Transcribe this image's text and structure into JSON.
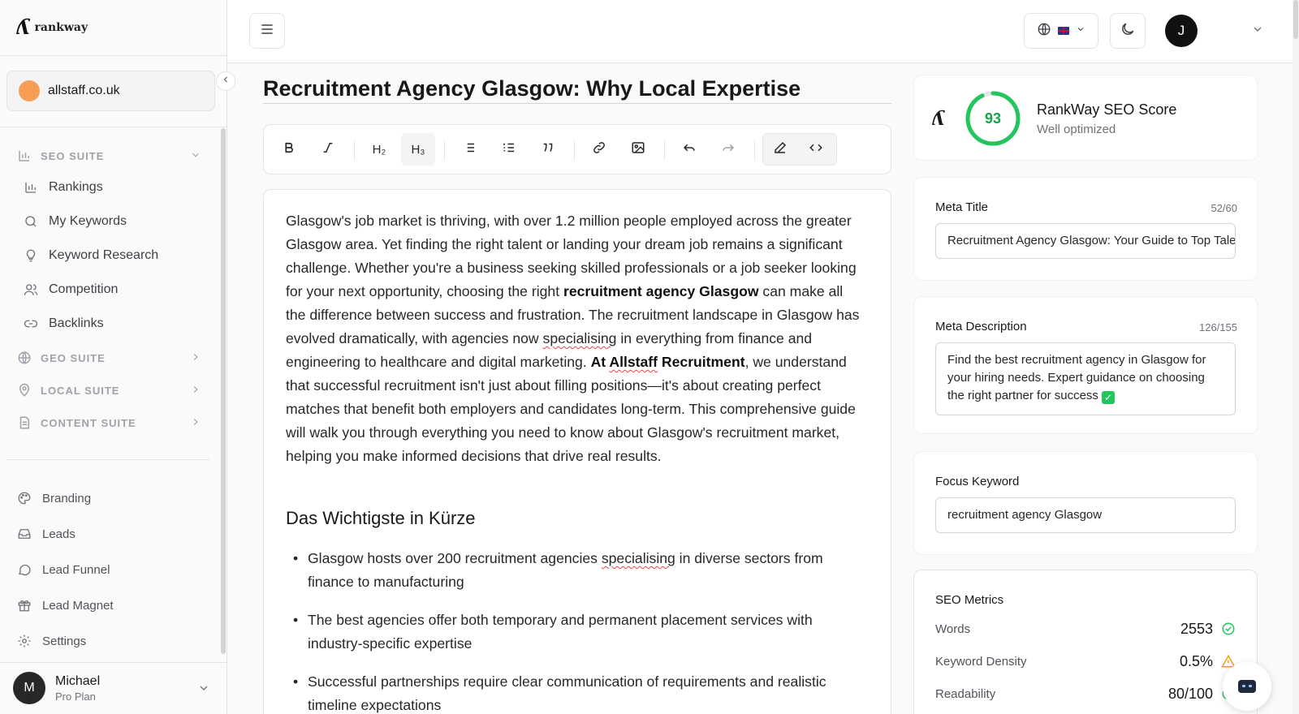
{
  "brand": {
    "name": "rankway",
    "mark": "ʎ"
  },
  "site": {
    "name": "allstaff.co.uk"
  },
  "sidebar": {
    "seo_suite": {
      "label": "SEO SUITE",
      "items": [
        {
          "label": "Rankings",
          "icon": "bar-chart-icon"
        },
        {
          "label": "My Keywords",
          "icon": "search-icon"
        },
        {
          "label": "Keyword Research",
          "icon": "lightbulb-icon"
        },
        {
          "label": "Competition",
          "icon": "users-icon"
        },
        {
          "label": "Backlinks",
          "icon": "link-icon"
        }
      ]
    },
    "geo_suite": {
      "label": "GEO SUITE"
    },
    "local_suite": {
      "label": "LOCAL SUITE"
    },
    "content_suite": {
      "label": "CONTENT SUITE"
    },
    "bottom_items": [
      {
        "label": "Branding",
        "icon": "palette-icon"
      },
      {
        "label": "Leads",
        "icon": "inbox-icon"
      },
      {
        "label": "Lead Funnel",
        "icon": "chat-bubble-icon"
      },
      {
        "label": "Lead Magnet",
        "icon": "gift-icon"
      },
      {
        "label": "Settings",
        "icon": "gear-icon"
      }
    ],
    "user": {
      "initial": "M",
      "name": "Michael",
      "plan": "Pro Plan"
    }
  },
  "header": {
    "avatar_initial": "J",
    "language_flag": "UK"
  },
  "editor": {
    "title": "Recruitment Agency Glasgow: Why Local Expertise",
    "toolbar": {
      "h2": "H₂",
      "h3": "H₃"
    },
    "para": {
      "t1": "Glasgow's job market is thriving, with over 1.2 million people employed across the greater Glasgow area. Yet finding the right talent or landing your dream job remains a significant challenge. Whether you're a business seeking skilled professionals or a job seeker looking for your next opportunity, choosing the right ",
      "b1": "recruitment agency Glasgow",
      "t2": " can make all the difference between success and frustration. The recruitment landscape in Glasgow has evolved dramatically, with agencies now ",
      "s1": "specialising",
      "t3": " in everything from finance and engineering to healthcare and digital marketing. ",
      "b2a": "At ",
      "b2b": "Allstaff",
      "b2c": " Recruitment",
      "t4": ", we understand that successful recruitment isn't just about filling positions—it's about creating perfect matches that benefit both employers and candidates long-term. This comprehensive guide will walk you through everything you need to know about Glasgow's recruitment market, helping you make informed decisions that drive real results."
    },
    "heading": "Das Wichtigste in Kürze",
    "bullets": {
      "b1a": "Glasgow hosts over 200 recruitment agencies ",
      "b1s": "specialising",
      "b1b": " in diverse sectors from finance to manufacturing",
      "b2": "The best agencies offer both temporary and permanent placement services with industry-specific expertise",
      "b3": "Successful partnerships require clear communication of requirements and realistic timeline expectations"
    }
  },
  "seo_score": {
    "value": "93",
    "progress": 0.93,
    "title": "RankWay SEO Score",
    "status": "Well optimized",
    "color": "#22c55e"
  },
  "meta_title": {
    "label": "Meta Title",
    "count": "52/60",
    "value": "Recruitment Agency Glasgow: Your Guide to Top Talent"
  },
  "meta_description": {
    "label": "Meta Description",
    "count": "126/155",
    "value": "Find the best recruitment agency in Glasgow for your hiring needs. Expert guidance on choosing the right partner for success",
    "emoji": "✓"
  },
  "focus_keyword": {
    "label": "Focus Keyword",
    "value": "recruitment agency Glasgow"
  },
  "metrics": {
    "title": "SEO Metrics",
    "rows": [
      {
        "label": "Words",
        "value": "2553",
        "status": "ok"
      },
      {
        "label": "Keyword Density",
        "value": "0.5%",
        "status": "warning"
      },
      {
        "label": "Readability",
        "value": "80/100",
        "status": "ok"
      }
    ]
  }
}
